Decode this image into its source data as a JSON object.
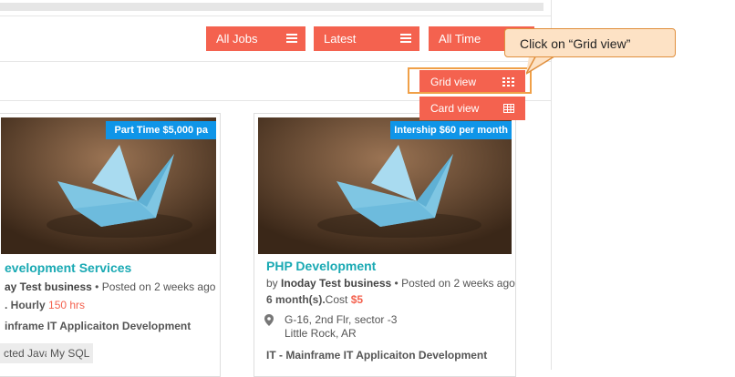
{
  "filters": {
    "all_jobs": "All Jobs",
    "latest": "Latest",
    "all_time": "All Time"
  },
  "view_menu": {
    "grid_view": "Grid view",
    "card_view": "Card view"
  },
  "callout": "Click on “Grid view”",
  "jobs": [
    {
      "badge": "Part Time $5,000 pa",
      "title": "evelopment Services",
      "by_company": "ay Test business",
      "posted": "Posted on 2 weeks ago",
      "rate_prefix": ". Hourly ",
      "rate_value": "150 hrs",
      "categories": "inframe   IT Applicaiton Development",
      "tags": [
        "cted Java",
        "My SQL"
      ]
    },
    {
      "badge": "Intership $60 per month",
      "title": "PHP Development",
      "by": "by",
      "company": "Inoday Test business",
      "posted": "Posted on 2 weeks ago",
      "duration": "6 month(s).",
      "cost_label": "Cost ",
      "cost_value": "$5",
      "address_line1": "G-16, 2nd Flr, sector -3",
      "address_line2": "Little Rock, AR",
      "categories": "IT - Mainframe   IT Applicaiton Development"
    }
  ],
  "colors": {
    "accent": "#f4624f",
    "badge": "#0f95e8",
    "title": "#19a9b3",
    "callout_bg": "#fde2c5",
    "callout_border": "#e08f3d"
  }
}
